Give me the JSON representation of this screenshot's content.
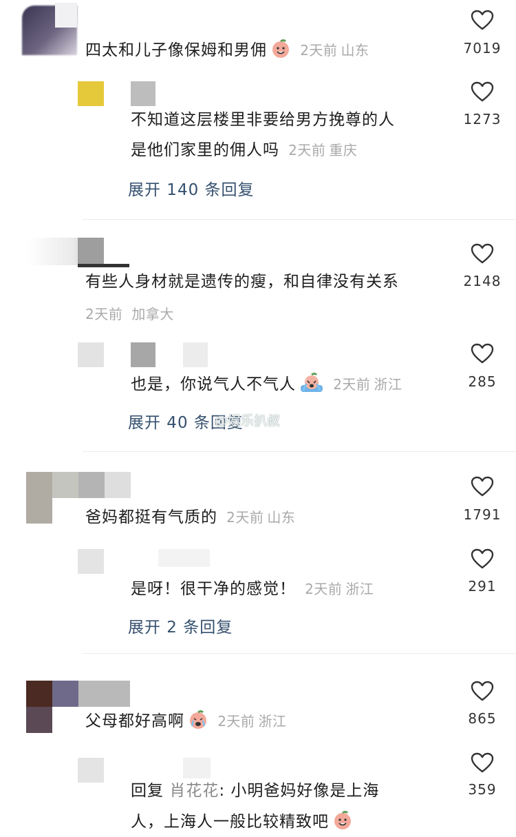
{
  "colors": {
    "link": "#35506f",
    "meta": "#a9a9a9",
    "text": "#1e1e1e"
  },
  "comments": [
    {
      "text": "四太和儿子像保姆和男佣",
      "time": "2天前",
      "location": "山东",
      "likes": "7019"
    },
    {
      "reply_line1": "不知道这层楼里非要给男方挽尊的人",
      "reply_line2": "是他们家里的佣人吗",
      "time": "2天前",
      "location": "重庆",
      "likes": "1273",
      "expand": "展开 140 条回复"
    },
    {
      "text": "有些人身材就是遗传的瘦，和自律没有关系",
      "time": "2天前",
      "location": "加拿大",
      "likes": "2148"
    },
    {
      "text": "也是，你说气人不气人",
      "time": "2天前",
      "location": "浙江",
      "likes": "285",
      "expand": "展开 40 条回复"
    },
    {
      "text": "爸妈都挺有气质的",
      "time": "2天前",
      "location": "山东",
      "likes": "1791"
    },
    {
      "text": "是呀！很干净的感觉！",
      "time": "2天前",
      "location": "浙江",
      "likes": "291",
      "expand": "展开 2 条回复"
    },
    {
      "text": "父母都好高啊",
      "time": "2天前",
      "location": "浙江",
      "likes": "865"
    },
    {
      "reply_prefix": "回复",
      "reply_to": "肖花花",
      "reply_line1": ": 小明爸妈好像是上海",
      "reply_line2": "人，上海人一般比较精致吧",
      "likes": "359"
    }
  ],
  "watermark": "@娱乐扒叔"
}
